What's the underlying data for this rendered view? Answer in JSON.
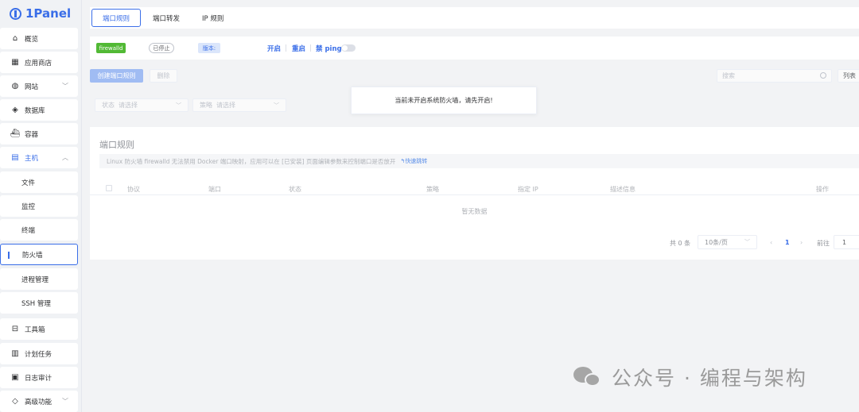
{
  "app": {
    "logo_text": "1Panel"
  },
  "sidebar": {
    "items": [
      {
        "label": "概览",
        "icon": "home-icon"
      },
      {
        "label": "应用商店",
        "icon": "apps-icon"
      },
      {
        "label": "网站",
        "icon": "globe-icon"
      },
      {
        "label": "数据库",
        "icon": "database-icon"
      },
      {
        "label": "容器",
        "icon": "container-icon"
      },
      {
        "label": "主机",
        "icon": "host-icon"
      },
      {
        "label": "文件"
      },
      {
        "label": "监控"
      },
      {
        "label": "终端"
      },
      {
        "label": "防火墙"
      },
      {
        "label": "进程管理"
      },
      {
        "label": "SSH 管理"
      },
      {
        "label": "工具箱",
        "icon": "toolbox-icon"
      },
      {
        "label": "计划任务",
        "icon": "calendar-icon"
      },
      {
        "label": "日志审计",
        "icon": "log-icon"
      },
      {
        "label": "高级功能",
        "icon": "diamond-icon"
      }
    ],
    "active_item": "防火墙"
  },
  "tabs": [
    {
      "label": "端口规则"
    },
    {
      "label": "端口转发"
    },
    {
      "label": "IP 规则"
    }
  ],
  "status": {
    "name": "firewalld",
    "state": "已停止",
    "version_label": "版本:",
    "start": "开启",
    "restart": "重启",
    "ping": "禁 ping"
  },
  "toolbar": {
    "create": "创建端口规则",
    "delete": "删除",
    "search_placeholder": "搜索",
    "list_label": "列表"
  },
  "filters": {
    "status_label": "状态",
    "status_placeholder": "请选择",
    "strategy_label": "策略",
    "strategy_placeholder": "请选择"
  },
  "toast": {
    "message": "当前未开启系统防火墙，请先开启!"
  },
  "card": {
    "title": "端口规则",
    "notice": "Linux 防火墙 firewalld 无法禁用 Docker 端口映射，应用可以在 [已安装] 页面编辑参数来控制端口是否放开",
    "notice_link": "快速跳转",
    "columns": [
      "协议",
      "端口",
      "状态",
      "策略",
      "指定 IP",
      "描述信息",
      "操作"
    ],
    "empty": "暂无数据"
  },
  "pagination": {
    "total": "共 0 条",
    "page_size": "10条/页",
    "current": "1",
    "goto_label": "前往",
    "goto_value": "1"
  },
  "watermark": {
    "text": "公众号 · 编程与架构"
  },
  "colors": {
    "accent": "#3a6ee8",
    "success": "#52b935"
  }
}
